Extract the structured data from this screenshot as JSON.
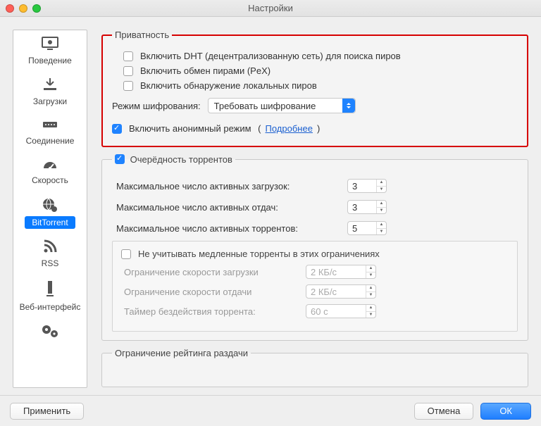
{
  "window": {
    "title": "Настройки"
  },
  "sidebar": [
    {
      "label": "Поведение",
      "icon": "monitor-gear-icon",
      "selected": false
    },
    {
      "label": "Загрузки",
      "icon": "download-icon",
      "selected": false
    },
    {
      "label": "Соединение",
      "icon": "network-icon",
      "selected": false
    },
    {
      "label": "Скорость",
      "icon": "gauge-icon",
      "selected": false
    },
    {
      "label": "BitTorrent",
      "icon": "globe-gear-icon",
      "selected": true
    },
    {
      "label": "RSS",
      "icon": "rss-icon",
      "selected": false
    },
    {
      "label": "Веб-интерфейс",
      "icon": "server-icon",
      "selected": false
    },
    {
      "label": "",
      "icon": "cogs-icon",
      "selected": false
    }
  ],
  "privacy": {
    "legend": "Приватность",
    "dht": {
      "checked": false,
      "label": "Включить DHT (децентрализованную сеть) для поиска пиров"
    },
    "pex": {
      "checked": false,
      "label": "Включить обмен пирами (PeX)"
    },
    "lpd": {
      "checked": false,
      "label": "Включить обнаружение локальных пиров"
    },
    "enc_label": "Режим шифрования:",
    "enc_value": "Требовать шифрование",
    "anon": {
      "checked": true,
      "label": "Включить анонимный режим"
    },
    "more_text": "Подробнее"
  },
  "queue": {
    "toggle": {
      "checked": true,
      "label": "Очерёдность торрентов"
    },
    "max_active_downloads": {
      "label": "Максимальное число активных загрузок:",
      "value": "3"
    },
    "max_active_uploads": {
      "label": "Максимальное число активных отдач:",
      "value": "3"
    },
    "max_active_torrents": {
      "label": "Максимальное число активных торрентов:",
      "value": "5"
    },
    "ignore_slow": {
      "checked": false,
      "label": "Не учитывать медленные торренты в этих ограничениях"
    },
    "slow_dl": {
      "label": "Ограничение скорости загрузки",
      "value": "2 КБ/с"
    },
    "slow_ul": {
      "label": "Ограничение скорости отдачи",
      "value": "2 КБ/с"
    },
    "inactivity": {
      "label": "Таймер бездействия торрента:",
      "value": "60 с"
    }
  },
  "ratio": {
    "legend": "Ограничение рейтинга раздачи"
  },
  "buttons": {
    "apply": "Применить",
    "cancel": "Отмена",
    "ok": "ОК"
  }
}
